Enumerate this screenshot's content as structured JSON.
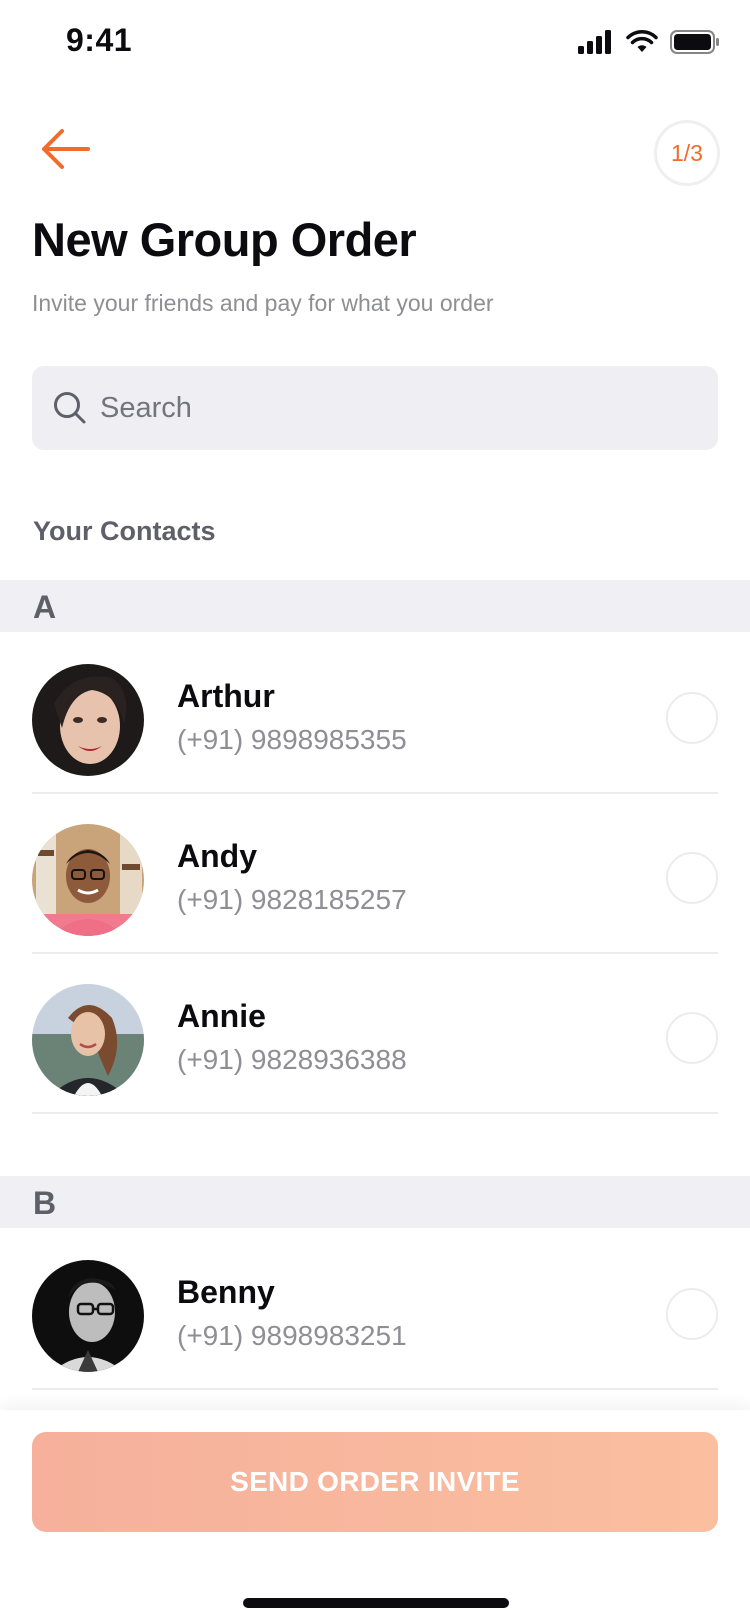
{
  "status_bar": {
    "time": "9:41",
    "icons": [
      "cellular-signal-icon",
      "wifi-icon",
      "battery-icon"
    ]
  },
  "header": {
    "back_icon": "arrow-left-icon",
    "step_indicator": "1/3",
    "title": "New Group Order",
    "subtitle": "Invite your friends and pay for what you order"
  },
  "search": {
    "placeholder": "Search",
    "value": "",
    "icon": "search-icon"
  },
  "contacts": {
    "section_title": "Your Contacts",
    "groups": [
      {
        "letter": "A",
        "items": [
          {
            "name": "Arthur",
            "phone": "(+91) 9898985355",
            "selected": false
          },
          {
            "name": "Andy",
            "phone": "(+91) 9828185257",
            "selected": false
          },
          {
            "name": "Annie",
            "phone": "(+91) 9828936388",
            "selected": false
          }
        ]
      },
      {
        "letter": "B",
        "items": [
          {
            "name": "Benny",
            "phone": "(+91) 9898983251",
            "selected": false
          }
        ]
      }
    ]
  },
  "footer": {
    "button_label": "SEND ORDER INVITE"
  },
  "colors": {
    "accent": "#f26b2a",
    "button_bg": "#f8b89e",
    "group_header_bg": "#efeff4",
    "search_bg": "#efeff3"
  }
}
